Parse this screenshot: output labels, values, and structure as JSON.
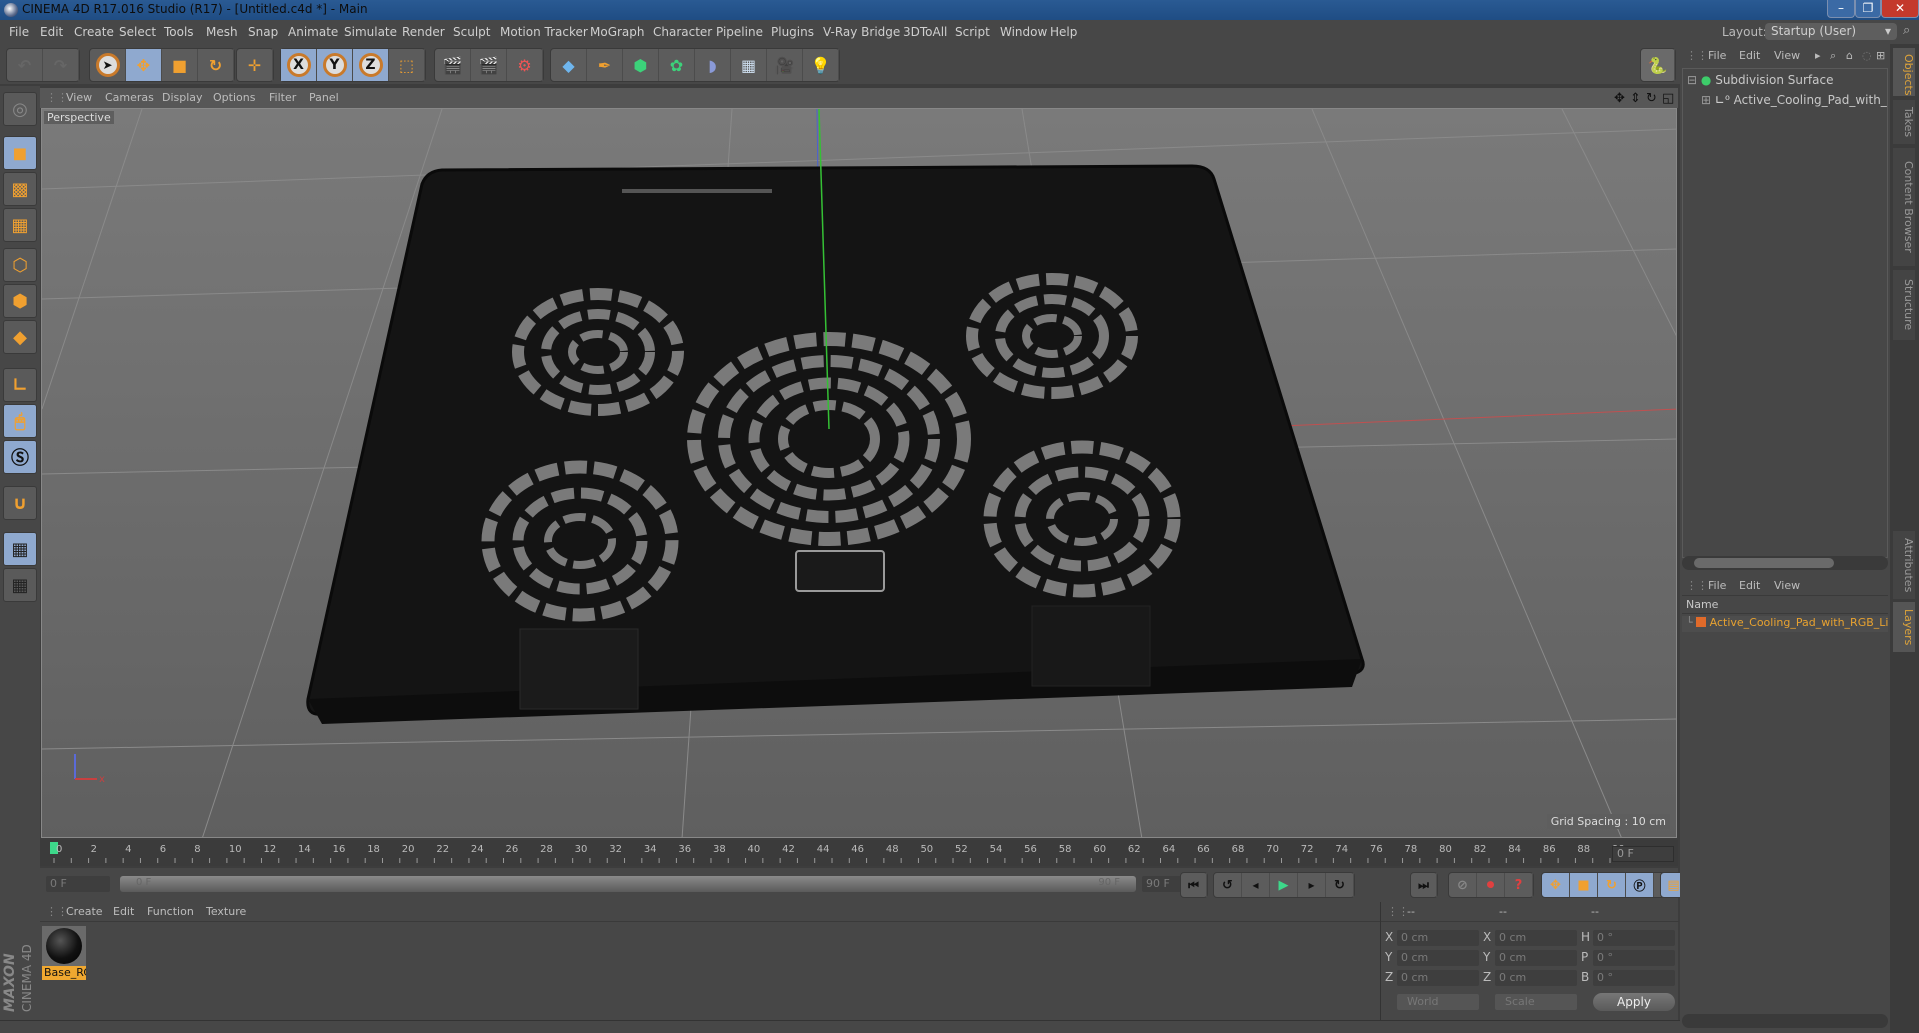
{
  "window": {
    "title": "CINEMA 4D R17.016 Studio (R17) - [Untitled.c4d *] - Main",
    "controls": {
      "minimize": "–",
      "restore": "❐",
      "close": "✕"
    }
  },
  "menubar": {
    "items": [
      "File",
      "Edit",
      "Create",
      "Select",
      "Tools",
      "Mesh",
      "Snap",
      "Animate",
      "Simulate",
      "Render",
      "Sculpt",
      "Motion Tracker",
      "MoGraph",
      "Character",
      "Pipeline",
      "Plugins",
      "V-Ray Bridge",
      "3DToAll",
      "Script",
      "Window",
      "Help"
    ],
    "layout_label": "Layout:",
    "layout_value": "Startup (User)"
  },
  "toolbar": {
    "undo_icons": [
      "undo-icon",
      "redo-icon"
    ],
    "mode_tools": [
      "select-pointer-icon",
      "move-icon",
      "scale-icon",
      "rotate-icon"
    ],
    "extra_move": "live-move-icon",
    "axis_labels": [
      "X",
      "Y",
      "Z"
    ],
    "coord_system": "world-coordinate-icon",
    "render_icons": [
      "render-view-icon",
      "render-picture-viewer-icon",
      "render-settings-icon"
    ],
    "object_icons": [
      "cube-primitive-icon",
      "pen-spline-icon",
      "subdivision-icon",
      "cloner-icon",
      "deformer-icon",
      "floor-icon",
      "camera-icon",
      "light-icon"
    ],
    "python_icon": "python-icon"
  },
  "left_tools": [
    "workplane-icon",
    "model-mode-icon",
    "texture-mode-icon",
    "workplane-grid-icon",
    "points-mode-icon",
    "edges-mode-icon",
    "polygons-mode-icon",
    "axis-mode-icon",
    "tweak-mode-icon",
    "solo-mode-icon",
    "snap-icon",
    "locked-workplane-icon",
    "planar-workplane-icon"
  ],
  "viewport": {
    "menu": [
      "View",
      "Cameras",
      "Display",
      "Options",
      "Filter",
      "Panel"
    ],
    "camera_label": "Perspective",
    "grid_spacing": "Grid Spacing : 10 cm",
    "nav_icons": [
      "pan-icon",
      "dolly-icon",
      "orbit-icon",
      "maximize-view-icon"
    ]
  },
  "timeline": {
    "ticks": [
      0,
      2,
      4,
      6,
      8,
      10,
      12,
      14,
      16,
      18,
      20,
      22,
      24,
      26,
      28,
      30,
      32,
      34,
      36,
      38,
      40,
      42,
      44,
      46,
      48,
      50,
      52,
      54,
      56,
      58,
      60,
      62,
      64,
      66,
      68,
      70,
      72,
      74,
      76,
      78,
      80,
      82,
      84,
      86,
      88,
      90
    ],
    "current_frame": "0 F",
    "start_field": "0 F",
    "range_start": "0 F",
    "range_end": "90 F",
    "end_field": "90 F"
  },
  "playback": {
    "buttons": [
      "go-to-start-icon",
      "previous-key-icon",
      "play-backwards-icon",
      "play-forward-icon",
      "next-frame-icon",
      "next-key-icon",
      "go-to-end-icon"
    ],
    "record_buttons": [
      "motion-record-icon",
      "autokey-icon",
      "keyframe-selection-icon"
    ],
    "key_buttons": [
      "key-position-icon",
      "key-scale-icon",
      "key-rotation-icon",
      "key-parameter-icon",
      "key-pla-icon"
    ],
    "timeline_icon": "timeline-window-icon"
  },
  "material_manager": {
    "menu": [
      "Create",
      "Edit",
      "Function",
      "Texture"
    ],
    "materials": [
      {
        "name": "Base_RC"
      }
    ],
    "brand_top": "MAXON",
    "brand_bottom": "CINEMA 4D"
  },
  "coordinates": {
    "headers": [
      "--",
      "--",
      "--"
    ],
    "rows": [
      {
        "l1": "X",
        "v1": "0 cm",
        "l2": "X",
        "v2": "0 cm",
        "l3": "H",
        "v3": "0 °"
      },
      {
        "l1": "Y",
        "v1": "0 cm",
        "l2": "Y",
        "v2": "0 cm",
        "l3": "P",
        "v3": "0 °"
      },
      {
        "l1": "Z",
        "v1": "0 cm",
        "l2": "Z",
        "v2": "0 cm",
        "l3": "B",
        "v3": "0 °"
      }
    ],
    "space_select": "World",
    "mode_select": "Scale",
    "apply_label": "Apply"
  },
  "object_manager": {
    "menu": [
      "File",
      "Edit",
      "View"
    ],
    "tree": [
      {
        "name": "Subdivision Surface",
        "level": 0
      },
      {
        "name": "Active_Cooling_Pad_with_RGB_Li",
        "level": 1
      }
    ]
  },
  "layer_manager": {
    "menu": [
      "File",
      "Edit",
      "View"
    ],
    "column_header": "Name",
    "layers": [
      {
        "name": "Active_Cooling_Pad_with_RGB_Lig",
        "color": "#e06a2a"
      }
    ]
  },
  "side_tabs_top": [
    {
      "label": "Objects",
      "active": true
    },
    {
      "label": "Takes",
      "active": false
    },
    {
      "label": "Content Browser",
      "active": false
    },
    {
      "label": "Structure",
      "active": false
    }
  ],
  "side_tabs_bottom": [
    {
      "label": "Attributes",
      "active": false
    },
    {
      "label": "Layers",
      "active": true
    }
  ],
  "colors": {
    "accent_orange": "#f0a030",
    "selected_blue": "#8fa9cf",
    "layer_text": "#e8a230"
  }
}
